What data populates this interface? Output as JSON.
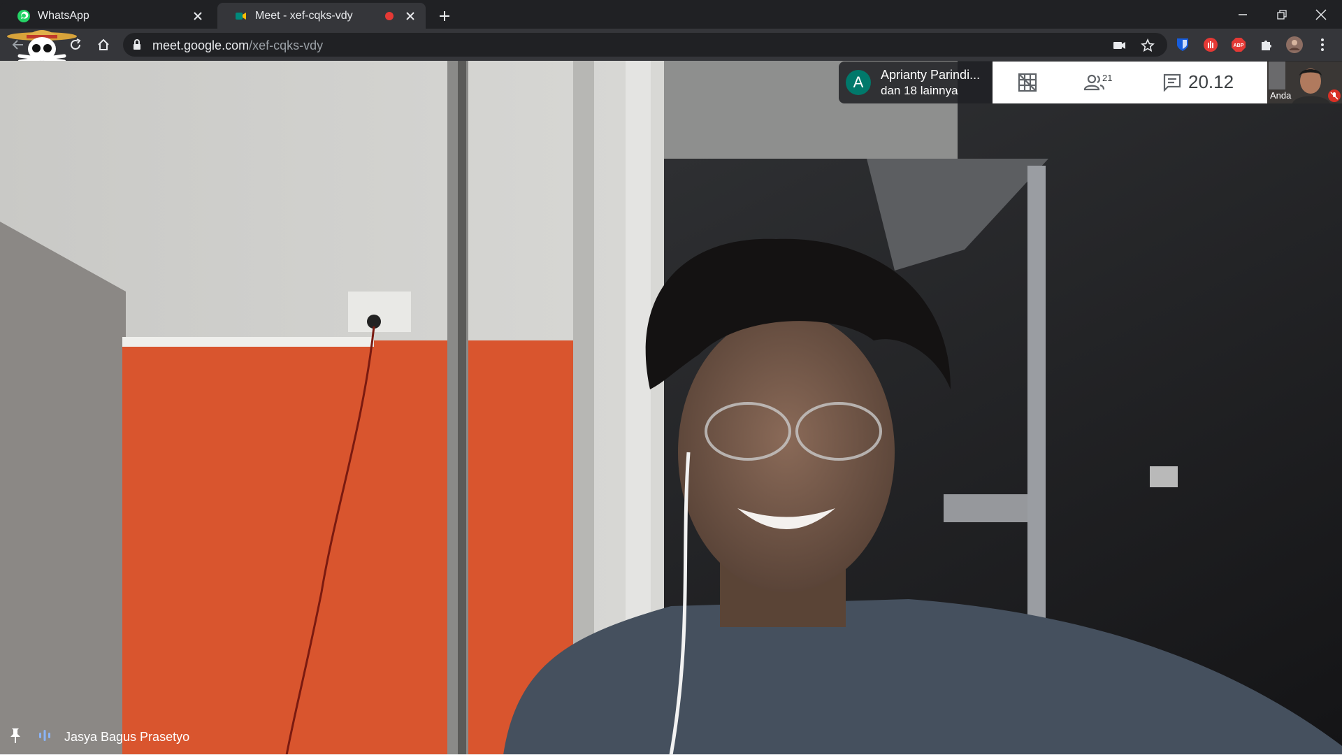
{
  "browser": {
    "tabs": [
      {
        "title": "WhatsApp"
      },
      {
        "title": "Meet - xef-cqks-vdy"
      }
    ],
    "url": {
      "host": "meet.google.com",
      "path": "/xef-cqks-vdy"
    }
  },
  "meet": {
    "participants_summary": {
      "avatar_letter": "A",
      "name": "Aprianty Parindi...",
      "others": "dan 18 lainnya"
    },
    "participant_count": "21",
    "time": "20.12",
    "self_label": "Anda",
    "active_speaker": "Jasya Bagus Prasetyo"
  },
  "colors": {
    "accent_green": "#1e8e3e",
    "meet_teal": "#00796b",
    "recording_red": "#e53935",
    "mic_off_red": "#d93025"
  },
  "icons": [
    "whatsapp-icon",
    "meet-icon",
    "close-icon",
    "plus-icon",
    "minimize-icon",
    "restore-icon",
    "window-close-icon",
    "back-icon",
    "reload-icon",
    "home-icon",
    "lock-icon",
    "camera-icon",
    "star-icon",
    "bitwarden-icon",
    "extension-hand-icon",
    "adblock-icon",
    "puzzle-icon",
    "profile-avatar-icon",
    "kebab-menu-icon",
    "tile-layout-icon",
    "people-icon",
    "chat-icon",
    "pin-icon",
    "audio-wave-icon",
    "mic-off-icon"
  ]
}
